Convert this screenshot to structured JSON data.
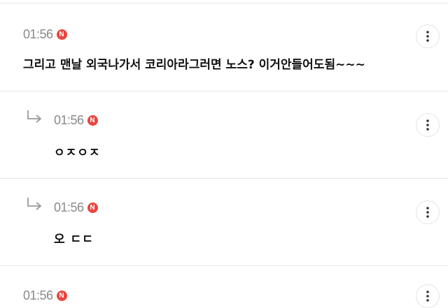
{
  "comments": [
    {
      "time": "01:56",
      "badge": "N",
      "text": "그리고 맨날 외국나가서 코리아라그러면 노스? 이거안들어도됨~~~",
      "is_reply": false
    },
    {
      "time": "01:56",
      "badge": "N",
      "text": "ㅇㅈㅇㅈ",
      "is_reply": true
    },
    {
      "time": "01:56",
      "badge": "N",
      "text": "오 ㄷㄷ",
      "is_reply": true
    },
    {
      "time": "01:56",
      "badge": "N",
      "text": "",
      "is_reply": false
    }
  ],
  "icons": {
    "more": "more-vertical-icon",
    "reply": "reply-arrow-icon",
    "badge": "new-badge-icon"
  },
  "colors": {
    "badge": "#e8463f",
    "time": "#8a8a8a",
    "text": "#111111",
    "divider": "#e6e6e6"
  }
}
